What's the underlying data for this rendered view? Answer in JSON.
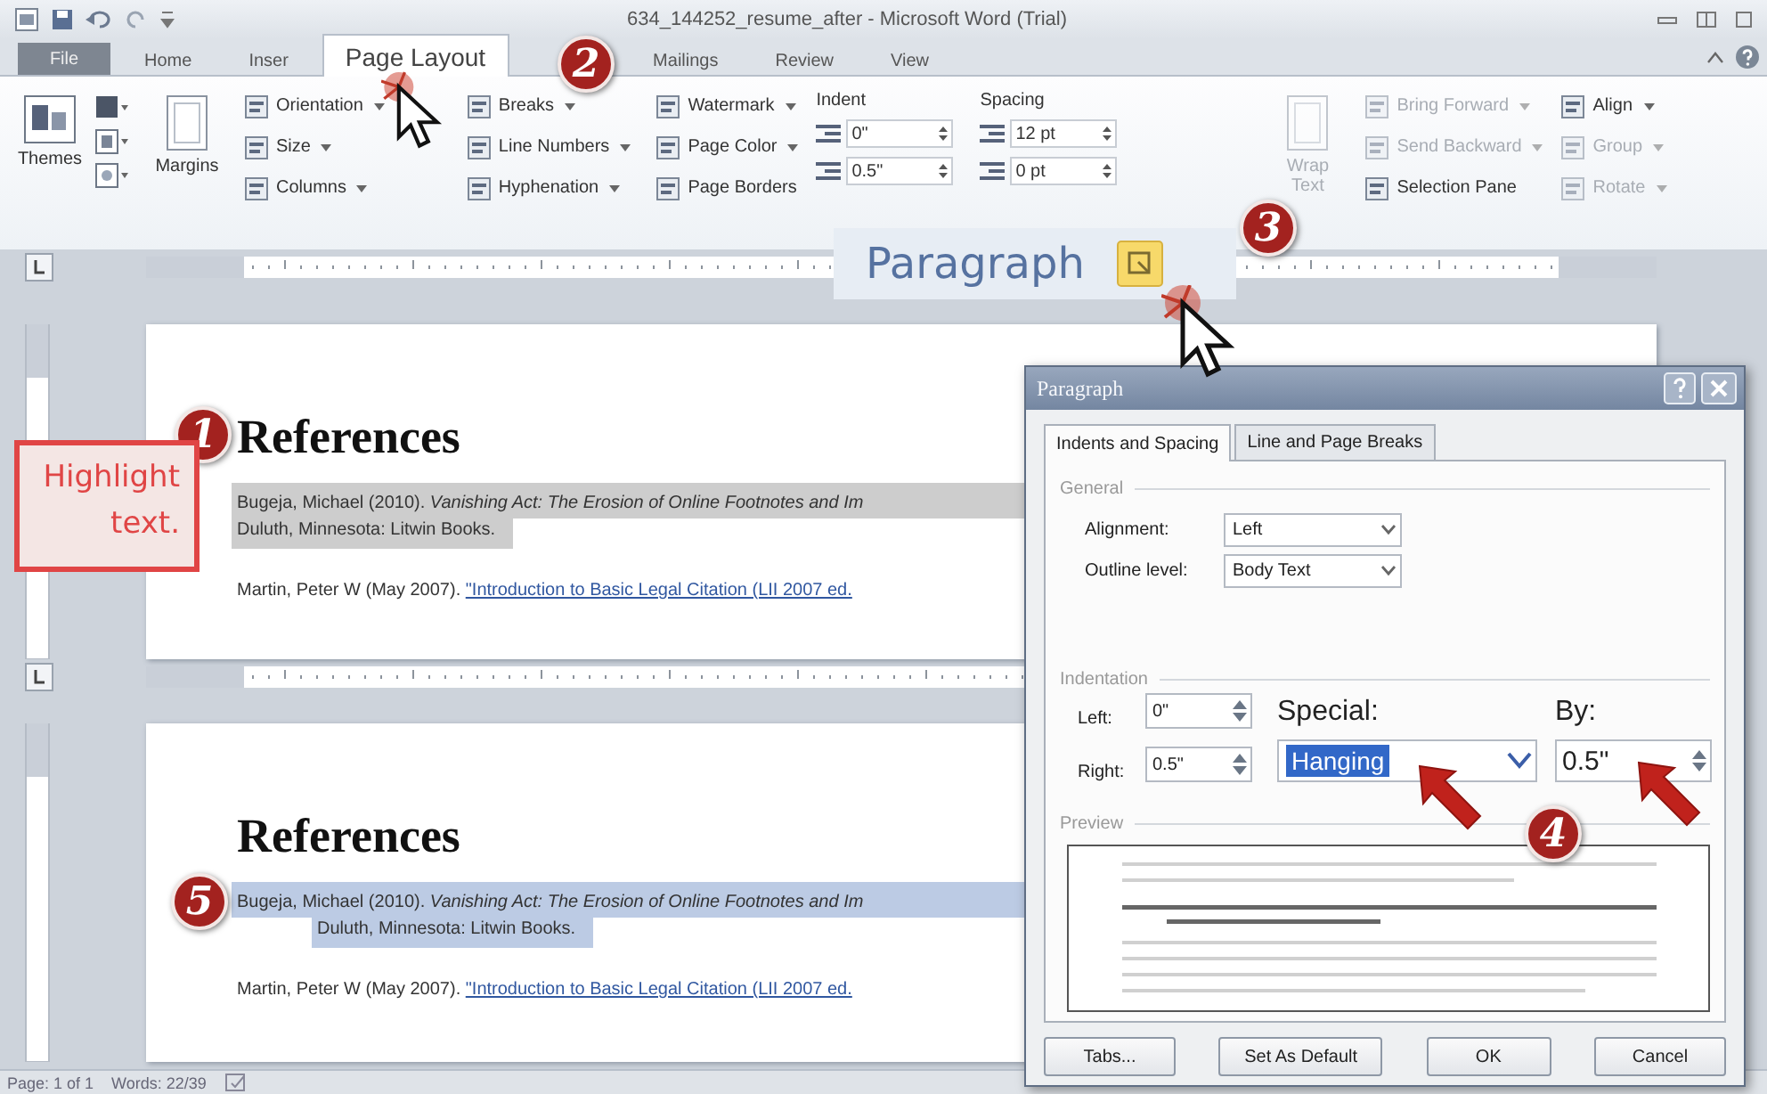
{
  "window": {
    "title": "634_144252_resume_after - Microsoft Word (Trial)"
  },
  "ribbon_tabs": [
    {
      "label": "File",
      "selected": false,
      "kind": "backstage"
    },
    {
      "label": "Home",
      "selected": false,
      "kind": "tab"
    },
    {
      "label": "Inser",
      "selected": false,
      "kind": "tab"
    },
    {
      "label": "Page Layout",
      "selected": true,
      "kind": "tab"
    },
    {
      "label": "Mailings",
      "selected": false,
      "kind": "tab"
    },
    {
      "label": "Review",
      "selected": false,
      "kind": "tab"
    },
    {
      "label": "View",
      "selected": false,
      "kind": "tab"
    }
  ],
  "ribbon": {
    "groups": [
      {
        "kind": "themes",
        "label": "Themes"
      },
      {
        "kind": "big",
        "label": "Margins",
        "disabled": false
      },
      {
        "kind": "stack",
        "items": [
          {
            "label": "Orientation",
            "dropdown": true,
            "disabled": false
          },
          {
            "label": "Size",
            "dropdown": true,
            "disabled": false
          },
          {
            "label": "Columns",
            "dropdown": true,
            "disabled": false
          }
        ]
      },
      {
        "kind": "stack",
        "items": [
          {
            "label": "Breaks",
            "dropdown": true,
            "disabled": false
          },
          {
            "label": "Line Numbers",
            "dropdown": true,
            "disabled": false
          },
          {
            "label": "Hyphenation",
            "dropdown": true,
            "disabled": false
          }
        ]
      },
      {
        "kind": "stack",
        "items": [
          {
            "label": "Watermark",
            "dropdown": true,
            "disabled": false
          },
          {
            "label": "Page Color",
            "dropdown": true,
            "disabled": false
          },
          {
            "label": "Page Borders",
            "dropdown": false,
            "disabled": false
          }
        ]
      },
      {
        "kind": "spinners",
        "label": "Indent",
        "fields": [
          "0\"",
          "0.5\""
        ]
      },
      {
        "kind": "spinners",
        "label": "Spacing",
        "fields": [
          "12 pt",
          "0 pt"
        ]
      },
      {
        "kind": "big",
        "label": "Wrap Text",
        "disabled": true
      },
      {
        "kind": "stack",
        "items": [
          {
            "label": "Bring Forward",
            "dropdown": true,
            "disabled": true
          },
          {
            "label": "Send Backward",
            "dropdown": true,
            "disabled": true
          },
          {
            "label": "Selection Pane",
            "dropdown": false,
            "disabled": false
          }
        ]
      },
      {
        "kind": "stack",
        "items": [
          {
            "label": "Align",
            "dropdown": true,
            "disabled": false
          },
          {
            "label": "Group",
            "dropdown": true,
            "disabled": true
          },
          {
            "label": "Rotate",
            "dropdown": true,
            "disabled": true
          }
        ]
      }
    ]
  },
  "paragraph_callout": {
    "label": "Paragraph"
  },
  "document": {
    "pages": [
      {
        "heading": "References",
        "entries": [
          {
            "text": "Bugeja, Michael (2010). *Vanishing Act: The Erosion of Online Footnotes and Im*",
            "continuation": "Duluth, Minnesota: Litwin Books.",
            "selected": true,
            "dimmed": true,
            "hanging": false
          },
          {
            "text": "Martin, Peter W (May 2007). ",
            "link": "\"Introduction to Basic Legal Citation (LII 2007 ed.",
            "selected": false
          }
        ]
      },
      {
        "heading": "References",
        "entries": [
          {
            "text": "Bugeja, Michael (2010). *Vanishing Act: The Erosion of Online Footnotes and Im*",
            "continuation": "Duluth, Minnesota: Litwin Books.",
            "selected": true,
            "dimmed": false,
            "hanging": true
          },
          {
            "text": "Martin, Peter W (May 2007). ",
            "link": "\"Introduction to Basic Legal Citation (LII 2007 ed.",
            "selected": false
          }
        ]
      }
    ]
  },
  "dialog": {
    "title": "Paragraph",
    "tabs": [
      {
        "label": "Indents and Spacing",
        "selected": true
      },
      {
        "label": "Line and Page Breaks",
        "selected": false
      }
    ],
    "general": {
      "heading": "General",
      "alignment": {
        "label": "Alignment:",
        "value": "Left"
      },
      "outline_level": {
        "label": "Outline level:",
        "value": "Body Text"
      }
    },
    "indentation": {
      "heading": "Indentation",
      "left": {
        "label": "Left:",
        "value": "0\""
      },
      "right": {
        "label": "Right:",
        "value": "0.5\""
      },
      "special": {
        "label": "Special:",
        "value": "Hanging",
        "highlighted": true
      },
      "by": {
        "label": "By:",
        "value": "0.5\""
      }
    },
    "preview": {
      "heading": "Preview"
    },
    "buttons": [
      "Tabs...",
      "Set As Default",
      "OK",
      "Cancel"
    ]
  },
  "status_bar": {
    "items": [
      "Page: 1 of 1",
      "Words: 22/39"
    ]
  },
  "tutorial": {
    "badges": [
      "1",
      "2",
      "3",
      "4",
      "5"
    ],
    "callout": "Highlight text."
  }
}
